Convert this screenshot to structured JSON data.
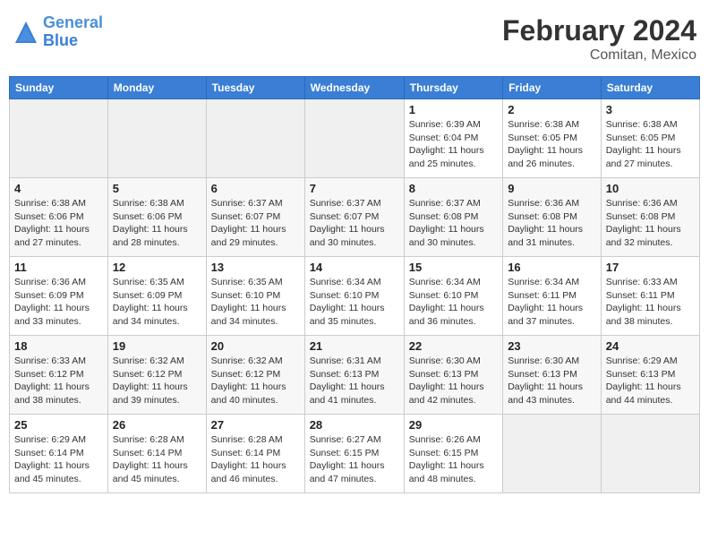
{
  "header": {
    "logo_line1": "General",
    "logo_line2": "Blue",
    "month": "February 2024",
    "location": "Comitan, Mexico"
  },
  "days_of_week": [
    "Sunday",
    "Monday",
    "Tuesday",
    "Wednesday",
    "Thursday",
    "Friday",
    "Saturday"
  ],
  "weeks": [
    [
      {
        "day": "",
        "info": ""
      },
      {
        "day": "",
        "info": ""
      },
      {
        "day": "",
        "info": ""
      },
      {
        "day": "",
        "info": ""
      },
      {
        "day": "1",
        "info": "Sunrise: 6:39 AM\nSunset: 6:04 PM\nDaylight: 11 hours\nand 25 minutes."
      },
      {
        "day": "2",
        "info": "Sunrise: 6:38 AM\nSunset: 6:05 PM\nDaylight: 11 hours\nand 26 minutes."
      },
      {
        "day": "3",
        "info": "Sunrise: 6:38 AM\nSunset: 6:05 PM\nDaylight: 11 hours\nand 27 minutes."
      }
    ],
    [
      {
        "day": "4",
        "info": "Sunrise: 6:38 AM\nSunset: 6:06 PM\nDaylight: 11 hours\nand 27 minutes."
      },
      {
        "day": "5",
        "info": "Sunrise: 6:38 AM\nSunset: 6:06 PM\nDaylight: 11 hours\nand 28 minutes."
      },
      {
        "day": "6",
        "info": "Sunrise: 6:37 AM\nSunset: 6:07 PM\nDaylight: 11 hours\nand 29 minutes."
      },
      {
        "day": "7",
        "info": "Sunrise: 6:37 AM\nSunset: 6:07 PM\nDaylight: 11 hours\nand 30 minutes."
      },
      {
        "day": "8",
        "info": "Sunrise: 6:37 AM\nSunset: 6:08 PM\nDaylight: 11 hours\nand 30 minutes."
      },
      {
        "day": "9",
        "info": "Sunrise: 6:36 AM\nSunset: 6:08 PM\nDaylight: 11 hours\nand 31 minutes."
      },
      {
        "day": "10",
        "info": "Sunrise: 6:36 AM\nSunset: 6:08 PM\nDaylight: 11 hours\nand 32 minutes."
      }
    ],
    [
      {
        "day": "11",
        "info": "Sunrise: 6:36 AM\nSunset: 6:09 PM\nDaylight: 11 hours\nand 33 minutes."
      },
      {
        "day": "12",
        "info": "Sunrise: 6:35 AM\nSunset: 6:09 PM\nDaylight: 11 hours\nand 34 minutes."
      },
      {
        "day": "13",
        "info": "Sunrise: 6:35 AM\nSunset: 6:10 PM\nDaylight: 11 hours\nand 34 minutes."
      },
      {
        "day": "14",
        "info": "Sunrise: 6:34 AM\nSunset: 6:10 PM\nDaylight: 11 hours\nand 35 minutes."
      },
      {
        "day": "15",
        "info": "Sunrise: 6:34 AM\nSunset: 6:10 PM\nDaylight: 11 hours\nand 36 minutes."
      },
      {
        "day": "16",
        "info": "Sunrise: 6:34 AM\nSunset: 6:11 PM\nDaylight: 11 hours\nand 37 minutes."
      },
      {
        "day": "17",
        "info": "Sunrise: 6:33 AM\nSunset: 6:11 PM\nDaylight: 11 hours\nand 38 minutes."
      }
    ],
    [
      {
        "day": "18",
        "info": "Sunrise: 6:33 AM\nSunset: 6:12 PM\nDaylight: 11 hours\nand 38 minutes."
      },
      {
        "day": "19",
        "info": "Sunrise: 6:32 AM\nSunset: 6:12 PM\nDaylight: 11 hours\nand 39 minutes."
      },
      {
        "day": "20",
        "info": "Sunrise: 6:32 AM\nSunset: 6:12 PM\nDaylight: 11 hours\nand 40 minutes."
      },
      {
        "day": "21",
        "info": "Sunrise: 6:31 AM\nSunset: 6:13 PM\nDaylight: 11 hours\nand 41 minutes."
      },
      {
        "day": "22",
        "info": "Sunrise: 6:30 AM\nSunset: 6:13 PM\nDaylight: 11 hours\nand 42 minutes."
      },
      {
        "day": "23",
        "info": "Sunrise: 6:30 AM\nSunset: 6:13 PM\nDaylight: 11 hours\nand 43 minutes."
      },
      {
        "day": "24",
        "info": "Sunrise: 6:29 AM\nSunset: 6:13 PM\nDaylight: 11 hours\nand 44 minutes."
      }
    ],
    [
      {
        "day": "25",
        "info": "Sunrise: 6:29 AM\nSunset: 6:14 PM\nDaylight: 11 hours\nand 45 minutes."
      },
      {
        "day": "26",
        "info": "Sunrise: 6:28 AM\nSunset: 6:14 PM\nDaylight: 11 hours\nand 45 minutes."
      },
      {
        "day": "27",
        "info": "Sunrise: 6:28 AM\nSunset: 6:14 PM\nDaylight: 11 hours\nand 46 minutes."
      },
      {
        "day": "28",
        "info": "Sunrise: 6:27 AM\nSunset: 6:15 PM\nDaylight: 11 hours\nand 47 minutes."
      },
      {
        "day": "29",
        "info": "Sunrise: 6:26 AM\nSunset: 6:15 PM\nDaylight: 11 hours\nand 48 minutes."
      },
      {
        "day": "",
        "info": ""
      },
      {
        "day": "",
        "info": ""
      }
    ]
  ]
}
